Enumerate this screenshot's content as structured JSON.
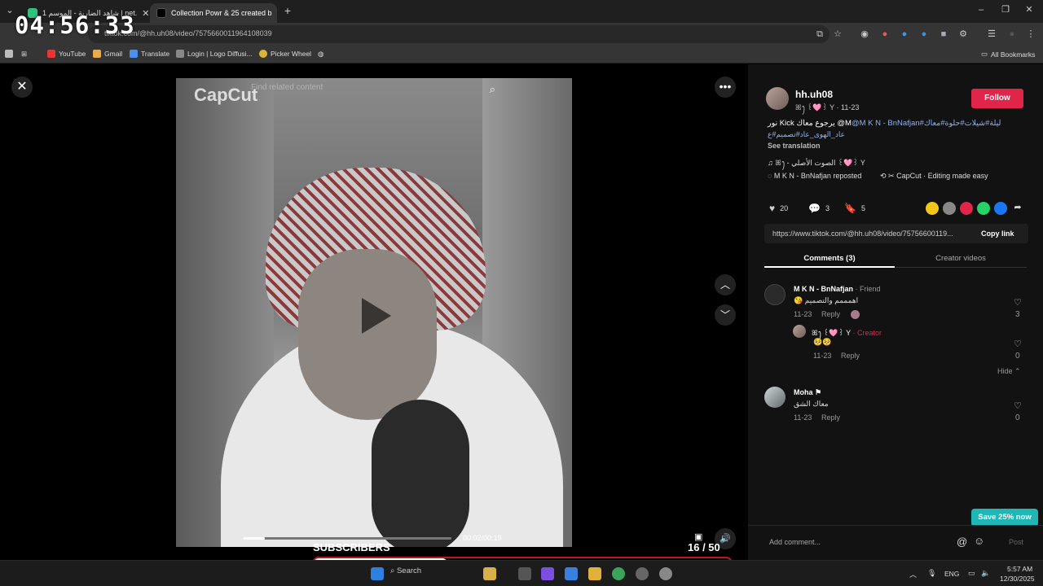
{
  "browser": {
    "tabs": [
      {
        "label": "شاهد الضاربة - الموسم 1 | net."
      },
      {
        "label": "Collection Powr & 25 created b"
      }
    ],
    "url": "tiktok.com/@hh.uh08/video/7575660011964108039",
    "bookmarks": [
      "YouTube",
      "Gmail",
      "Translate",
      "Login | Logo Diffusi...",
      "Picker Wheel"
    ],
    "all_bookmarks": "All Bookmarks"
  },
  "overlay": {
    "clock": "04:56:33",
    "subscribers_label": "SUBSCRIBERS",
    "subscribers_count": "16 / 50",
    "subscribers_progress": 0.32
  },
  "video": {
    "watermark": "CapCut",
    "find_related": "Find related content",
    "time": "00:02/00:19",
    "progress": 0.105
  },
  "post": {
    "username": "hh.uh08",
    "userline": "ꕤꫂ ꒰🩷꒱ Y · 11-23",
    "follow_label": "Follow",
    "caption_line1": "نور Kick يرجوع معاك @M",
    "caption_mention": "@M K N - BnNafjan",
    "caption_tags": "#ليلة#شيلات#حلوة#معاك",
    "caption_line2": "عاد_الهوى_عاد#تصميم#ع",
    "see_translation": "See translation",
    "sound": "♫ ꕤꫂ - الصوت الأصلي ꒰🩷꒱ Y",
    "reposted": "M K N - BnNafjan reposted",
    "capcut_promo": "CapCut · Editing made easy",
    "likes": "20",
    "comments": "3",
    "saves": "5",
    "link": "https://www.tiktok.com/@hh.uh08/video/75756600119...",
    "copy_link": "Copy link",
    "tab_comments": "Comments (3)",
    "tab_creator": "Creator videos"
  },
  "comments": [
    {
      "author": "M K N - BnNafjan",
      "tag": " · Friend",
      "text": "😘 اهمممم والتصميم",
      "date": "11-23",
      "reply": "Reply",
      "likes": "3"
    },
    {
      "author": "ꕤꫂ ꒰🩷꒱ Y",
      "tag": " · Creator",
      "text": "🥺🥺",
      "date": "11-23",
      "reply": "Reply",
      "likes": "0"
    },
    {
      "author": "Moha",
      "tag": "",
      "text": "معاك الشق",
      "date": "11-23",
      "reply": "Reply",
      "likes": "0"
    }
  ],
  "hide_label": "Hide ⌃",
  "save_promo": "Save 25% now",
  "add_comment": "Add comment...",
  "post_label": "Post",
  "taskbar": {
    "search": "Search",
    "lang": "ENG",
    "time": "5:57 AM",
    "date": "12/30/2025"
  },
  "colors": {
    "follow": "#e0244a",
    "accent_link": "#8ab4f8",
    "save": "#1fb6b6",
    "creator": "#e0244a"
  }
}
